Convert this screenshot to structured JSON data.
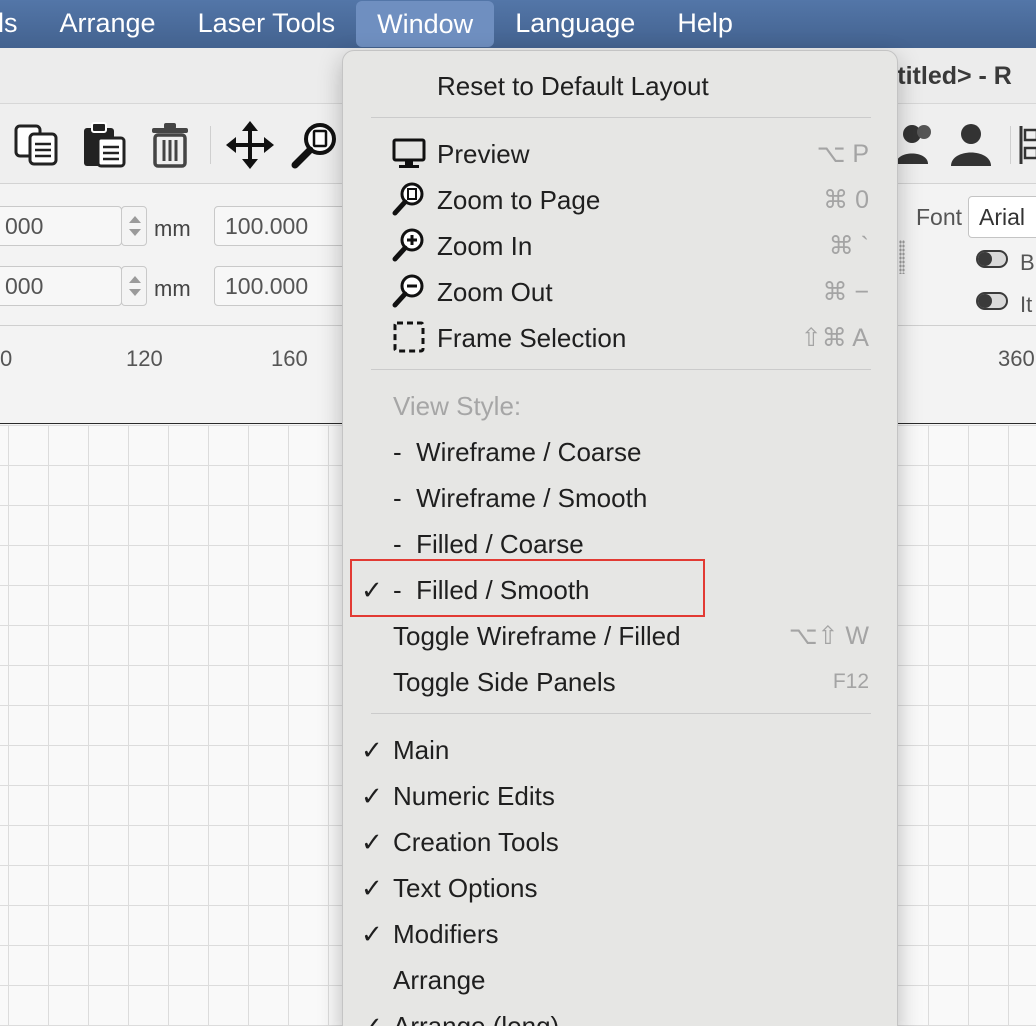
{
  "menubar": {
    "items": [
      "ls",
      "Arrange",
      "Laser Tools",
      "Window",
      "Language",
      "Help"
    ],
    "active_index": 3
  },
  "window": {
    "title_fragment": "ntitled> - R"
  },
  "numeric": {
    "x_value": "000",
    "y_value": "000",
    "width_value": "100.000",
    "height_value": "100.000",
    "unit": "mm",
    "font_label": "Font",
    "font_value": "Arial",
    "bold_label": "B",
    "italic_label": "It"
  },
  "ruler": {
    "ticks": [
      "0",
      "120",
      "160",
      "360"
    ]
  },
  "menu": {
    "reset": "Reset to Default Layout",
    "preview": {
      "label": "Preview",
      "shortcut": "⌥ P",
      "icon": "monitor-icon"
    },
    "zoom_page": {
      "label": "Zoom to Page",
      "shortcut": "⌘ 0",
      "icon": "zoom-page-icon"
    },
    "zoom_in": {
      "label": "Zoom In",
      "shortcut": "⌘ `",
      "icon": "zoom-in-icon"
    },
    "zoom_out": {
      "label": "Zoom Out",
      "shortcut": "⌘ −",
      "icon": "zoom-out-icon"
    },
    "frame_selection": {
      "label": "Frame Selection",
      "shortcut": "⇧⌘ A",
      "icon": "frame-selection-icon"
    },
    "view_style_header": "View Style:",
    "view_styles": [
      {
        "label": "-  Wireframe / Coarse",
        "checked": false
      },
      {
        "label": "-  Wireframe / Smooth",
        "checked": false
      },
      {
        "label": "-  Filled / Coarse",
        "checked": false
      },
      {
        "label": "-  Filled / Smooth",
        "checked": true
      }
    ],
    "toggle_wireframe": {
      "label": "Toggle Wireframe / Filled",
      "shortcut": "⌥⇧ W"
    },
    "toggle_side": {
      "label": "Toggle Side Panels",
      "shortcut": "F12"
    },
    "panels": [
      {
        "label": "Main",
        "checked": true
      },
      {
        "label": "Numeric Edits",
        "checked": true
      },
      {
        "label": "Creation Tools",
        "checked": true
      },
      {
        "label": "Text Options",
        "checked": true
      },
      {
        "label": "Modifiers",
        "checked": true
      },
      {
        "label": "Arrange",
        "checked": false
      },
      {
        "label": "Arrange (long)",
        "checked": true
      }
    ],
    "check_glyph": "✓"
  },
  "colors": {
    "menubar": "#4a6b9c",
    "highlight": "#e23a33",
    "menu_bg": "#e6e6e4"
  }
}
